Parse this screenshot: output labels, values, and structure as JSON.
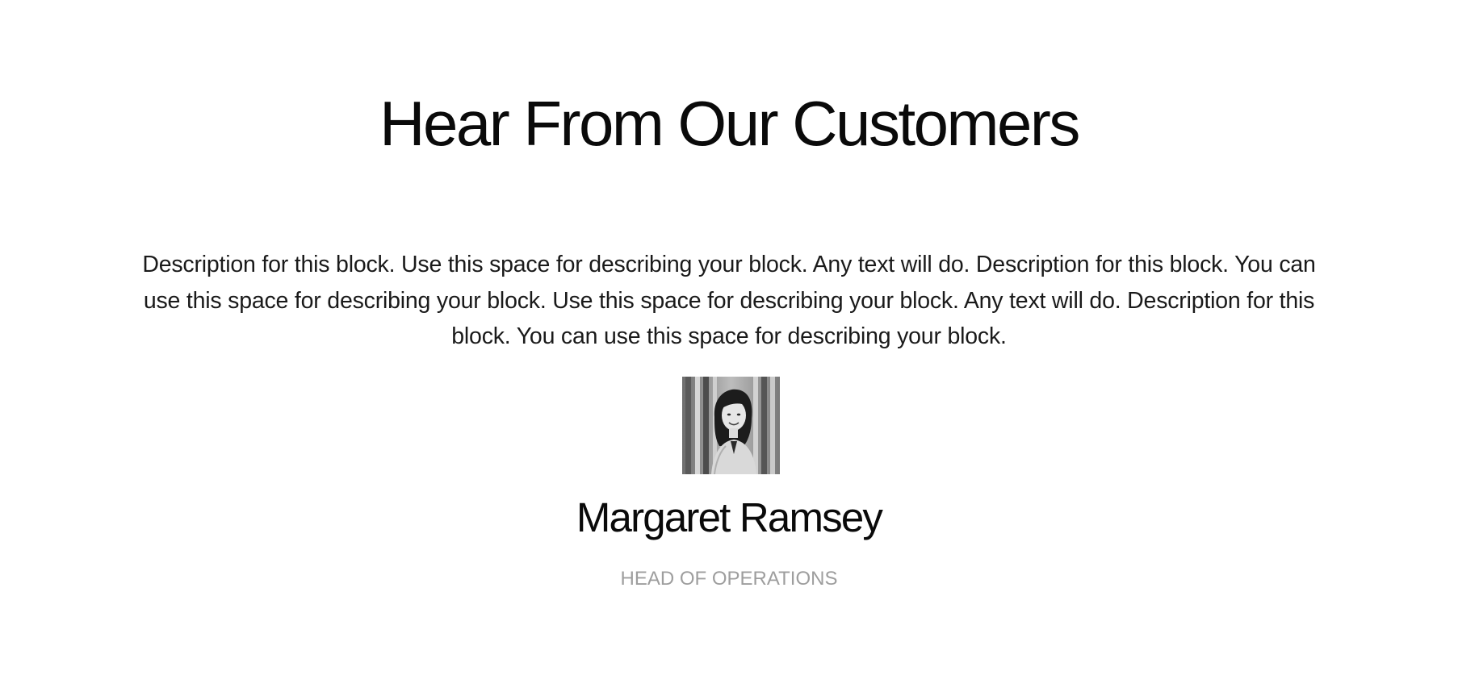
{
  "testimonial": {
    "title": "Hear From Our Customers",
    "description": "Description for this block. Use this space for describing your block. Any text will do. Description for this block. You can use this space for describing your block. Use this space for describing your block. Any text will do. Description for this block. You can use this space for describing your block.",
    "person": {
      "name": "Margaret Ramsey",
      "role": "HEAD OF OPERATIONS",
      "photo": "customer-avatar-photo"
    }
  },
  "colors": {
    "background": "#ffffff",
    "heading": "#0a0a0a",
    "body_text": "#1a1a1a",
    "role_text": "#9e9e9e"
  }
}
